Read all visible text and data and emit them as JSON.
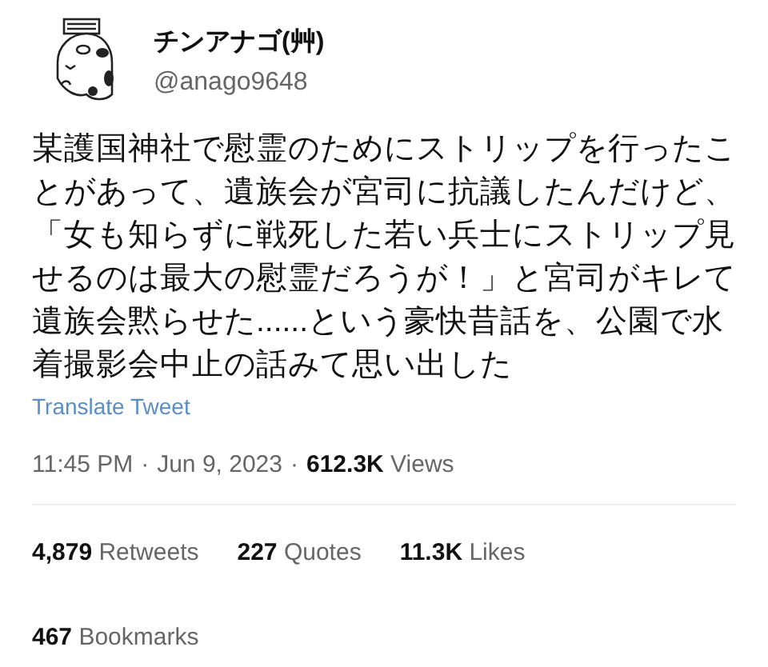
{
  "author": {
    "name": "チンアナゴ(艸)",
    "handle": "@anago9648"
  },
  "tweet": {
    "text": "某護国神社で慰霊のためにストリップを行ったことがあって、遺族会が宮司に抗議したんだけど、「女も知らずに戦死した若い兵士にストリップ見せるのは最大の慰霊だろうが！」と宮司がキレて遺族会黙らせた......という豪快昔話を、公園で水着撮影会中止の話みて思い出した",
    "translate": "Translate Tweet"
  },
  "meta": {
    "time": "11:45 PM",
    "separator_1": "·",
    "date": "Jun 9, 2023",
    "separator_2": "·",
    "views_count": "612.3K",
    "views_label": "Views"
  },
  "stats": [
    {
      "count": "4,879",
      "label": "Retweets"
    },
    {
      "count": "227",
      "label": "Quotes"
    },
    {
      "count": "11.3K",
      "label": "Likes"
    }
  ],
  "bookmarks": {
    "count": "467",
    "label": "Bookmarks"
  }
}
